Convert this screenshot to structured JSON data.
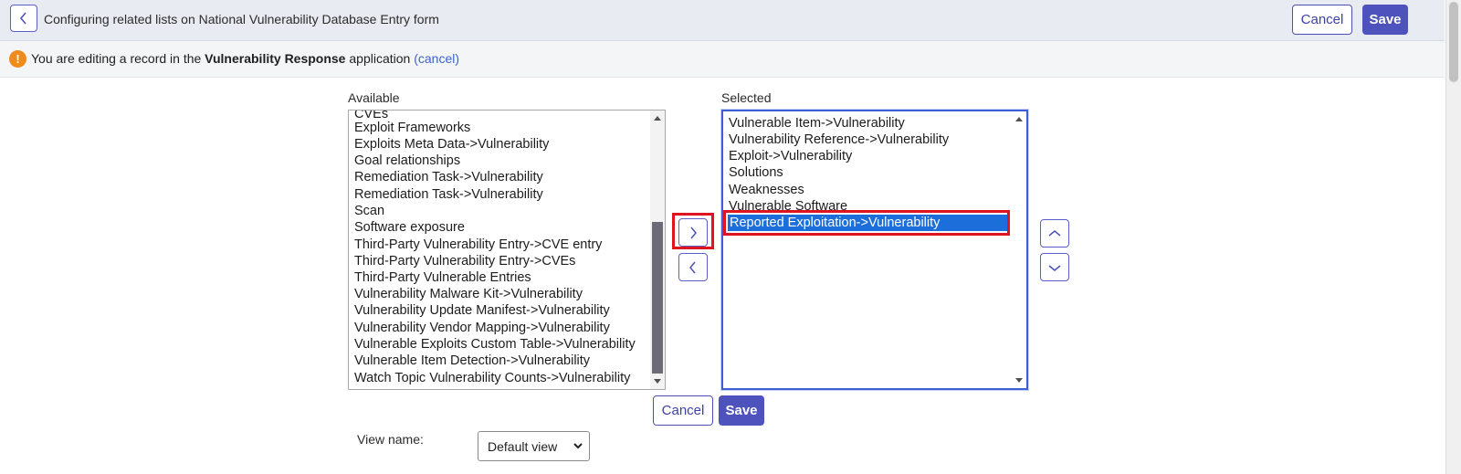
{
  "header": {
    "title": "Configuring related lists on National Vulnerability Database Entry form",
    "cancel_label": "Cancel",
    "save_label": "Save"
  },
  "notice": {
    "prefix": "You are editing a record in the",
    "app_name": "Vulnerability Response",
    "suffix": "application",
    "cancel_link": "(cancel)"
  },
  "available": {
    "label": "Available",
    "items": [
      "CVEs",
      "Exploit Frameworks",
      "Exploits Meta Data->Vulnerability",
      "Goal relationships",
      "Remediation Task->Vulnerability",
      "Remediation Task->Vulnerability",
      "Scan",
      "Software exposure",
      "Third-Party Vulnerability Entry->CVE entry",
      "Third-Party Vulnerability Entry->CVEs",
      "Third-Party Vulnerable Entries",
      "Vulnerability Malware Kit->Vulnerability",
      "Vulnerability Update Manifest->Vulnerability",
      "Vulnerability Vendor Mapping->Vulnerability",
      "Vulnerable Exploits Custom Table->Vulnerability",
      "Vulnerable Item Detection->Vulnerability",
      "Watch Topic Vulnerability Counts->Vulnerability"
    ]
  },
  "selected": {
    "label": "Selected",
    "items": [
      "Vulnerable Item->Vulnerability",
      "Vulnerability Reference->Vulnerability",
      "Exploit->Vulnerability",
      "Solutions",
      "Weaknesses",
      "Vulnerable Software",
      "Reported Exploitation->Vulnerability"
    ],
    "highlighted_index": 6
  },
  "icons": {
    "back": "chevron-left-icon",
    "add": "chevron-right-icon",
    "remove": "chevron-left-icon",
    "move_up": "chevron-up-icon",
    "move_down": "chevron-down-icon",
    "warning": "exclamation-icon",
    "warning_glyph": "!"
  },
  "footer": {
    "cancel_label": "Cancel",
    "save_label": "Save",
    "view_name_label": "View name:",
    "view_name_value": "Default view"
  },
  "colors": {
    "accent": "#4d52bd",
    "selection": "#1c6fdb",
    "highlight_frame": "#e0141f",
    "warning": "#f08a1c"
  }
}
